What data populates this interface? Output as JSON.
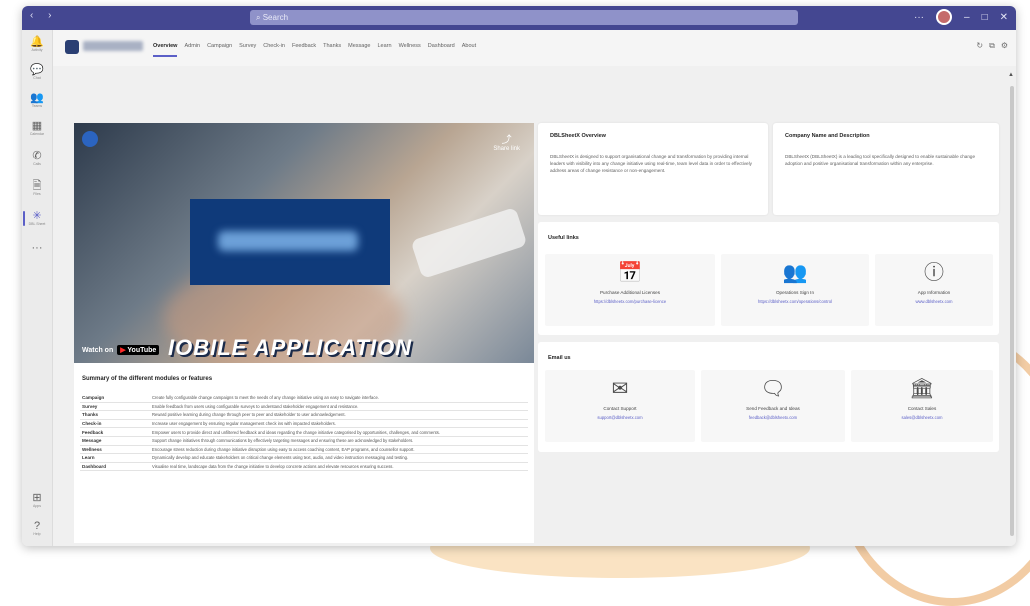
{
  "search": {
    "placeholder": "Search"
  },
  "titlebar": {
    "nav_arrows": "‹ ›",
    "more": "···",
    "minimize": "–",
    "maximize": "□",
    "close": "✕"
  },
  "rail": [
    {
      "label": "Activity",
      "icon": "bell-icon",
      "glyph": "🔔"
    },
    {
      "label": "Chat",
      "icon": "chat-icon",
      "glyph": "💬"
    },
    {
      "label": "Teams",
      "icon": "teams-icon",
      "glyph": "👥"
    },
    {
      "label": "Calendar",
      "icon": "calendar-icon",
      "glyph": "▦"
    },
    {
      "label": "Calls",
      "icon": "phone-icon",
      "glyph": "✆"
    },
    {
      "label": "Files",
      "icon": "files-icon",
      "glyph": "🗎"
    },
    {
      "label": "DBL Sheet",
      "icon": "app-icon",
      "glyph": "✳"
    },
    {
      "label": "",
      "icon": "more-icon",
      "glyph": "···"
    }
  ],
  "rail_bottom": [
    {
      "label": "Apps",
      "icon": "apps-icon",
      "glyph": "⊞"
    },
    {
      "label": "Help",
      "icon": "help-icon",
      "glyph": "?"
    }
  ],
  "tabs": [
    "Overview",
    "Admin",
    "Campaign",
    "Survey",
    "Check-in",
    "Feedback",
    "Thanks",
    "Message",
    "Learn",
    "Wellness",
    "Dashboard",
    "About"
  ],
  "head_icons": [
    "↻",
    "⧉",
    "⚙"
  ],
  "video": {
    "watch_on": "Watch on",
    "youtube": "YouTube",
    "share": "Share link",
    "caption": "IOBILE APPLICATION"
  },
  "summary": {
    "title": "Summary of the different modules or features",
    "rows": [
      {
        "k": "Campaign",
        "v": "Create fully configurable change campaigns to meet the needs of any change initiative using an easy to navigate interface."
      },
      {
        "k": "Survey",
        "v": "Enable feedback from users using configurable surveys to understand stakeholder engagement and resistance."
      },
      {
        "k": "Thanks",
        "v": "Reward positive learning during change through peer to peer and stakeholder to user acknowledgement."
      },
      {
        "k": "Check-in",
        "v": "Increase user engagement by ensuring regular management check ins with impacted stakeholders."
      },
      {
        "k": "Feedback",
        "v": "Empower users to provide direct and unfiltered feedback and ideas regarding the change initiative categorised by opportunities, challenges, and comments."
      },
      {
        "k": "Message",
        "v": "Support change initiatives through communications by effectively targeting messages and ensuring these are acknowledged by stakeholders."
      },
      {
        "k": "Wellness",
        "v": "Encourage stress reduction during change initiative disruption using easy to access coaching content, EAP programs, and counsellor support."
      },
      {
        "k": "Learn",
        "v": "Dynamically develop and educate stakeholders on critical change elements using text, audio, and video instruction messaging and testing."
      },
      {
        "k": "Dashboard",
        "v": "Visualise real time, landscape data from the change initiative to develop concrete actions and elevate resources ensuring success."
      }
    ]
  },
  "overview": {
    "title": "DBLSheetX Overview",
    "text": "DBLSheetX is designed to support organisational change and transformation by providing internal leaders with visibility into any change initiative using real-time, team level data in order to effectively address areas of change resistance or non-engagement."
  },
  "company": {
    "title": "Company Name and Description",
    "text": "DBLSheetX (DBLSheetX) is a leading tool specifically designed to enable sustainable change adoption and positive organisational transformation within any enterprise."
  },
  "useful_links": {
    "title": "Useful links",
    "items": [
      {
        "icon": "purchase-licenses-icon",
        "glyph": "📅",
        "label": "Purchase Additional Licenses",
        "url": "https://dblsheetx.com/purchase-licence"
      },
      {
        "icon": "operations-sign-in-icon",
        "glyph": "👥",
        "label": "Operations Sign In",
        "url": "https://dblsheetx.com/operations/control"
      },
      {
        "icon": "info-icon",
        "glyph": "ⓘ",
        "label": "App Information",
        "url": "www.dblsheetx.com"
      }
    ]
  },
  "email_us": {
    "title": "Email us",
    "items": [
      {
        "icon": "mail-icon",
        "glyph": "✉",
        "label": "Contact Support",
        "url": "support@dblsheetx.com"
      },
      {
        "icon": "feedback-icon",
        "glyph": "🗨",
        "label": "Send Feedback and Ideas",
        "url": "feedback@dblsheetx.com"
      },
      {
        "icon": "bank-icon",
        "glyph": "🏛",
        "label": "Contact Sales",
        "url": "sales@dblsheetx.com"
      }
    ]
  },
  "colors": {
    "titlebar": "#444791",
    "accent": "#5b5fc7",
    "video_banner": "#0f3a7a"
  }
}
